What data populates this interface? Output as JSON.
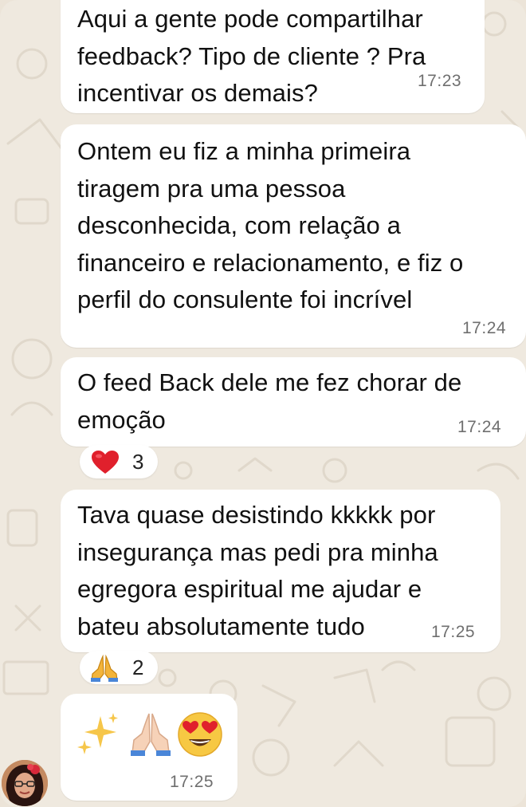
{
  "messages": [
    {
      "text": "Aqui a gente pode compartilhar\nfeedback? Tipo de cliente ? Pra\nincentivar os demais?",
      "time": "17:23"
    },
    {
      "text": "Ontem eu fiz a minha primeira\ntiragem pra uma pessoa\ndesconhecida, com relação a\nfinanceiro e relacionamento, e fiz o\nperfil do consulente foi incrível",
      "time": "17:24"
    },
    {
      "text": "O feed Back dele me fez chorar de\nemoção",
      "time": "17:24",
      "reaction": {
        "icon": "heart",
        "count": "3"
      }
    },
    {
      "text": "Tava quase desistindo kkkkk por\ninsegurança mas pedi pra minha\negregora espiritual me ajudar e\nbateu absolutamente tudo",
      "time": "17:25",
      "reaction": {
        "icon": "praying-hands",
        "count": "2"
      }
    },
    {
      "emojis": [
        "sparkles",
        "praying-hands",
        "heart-eyes-face"
      ],
      "time": "17:25"
    }
  ],
  "colors": {
    "background": "#efe9df",
    "bubble": "#ffffff",
    "timestamp": "#6f6f6f",
    "heart": "#e0202c"
  }
}
